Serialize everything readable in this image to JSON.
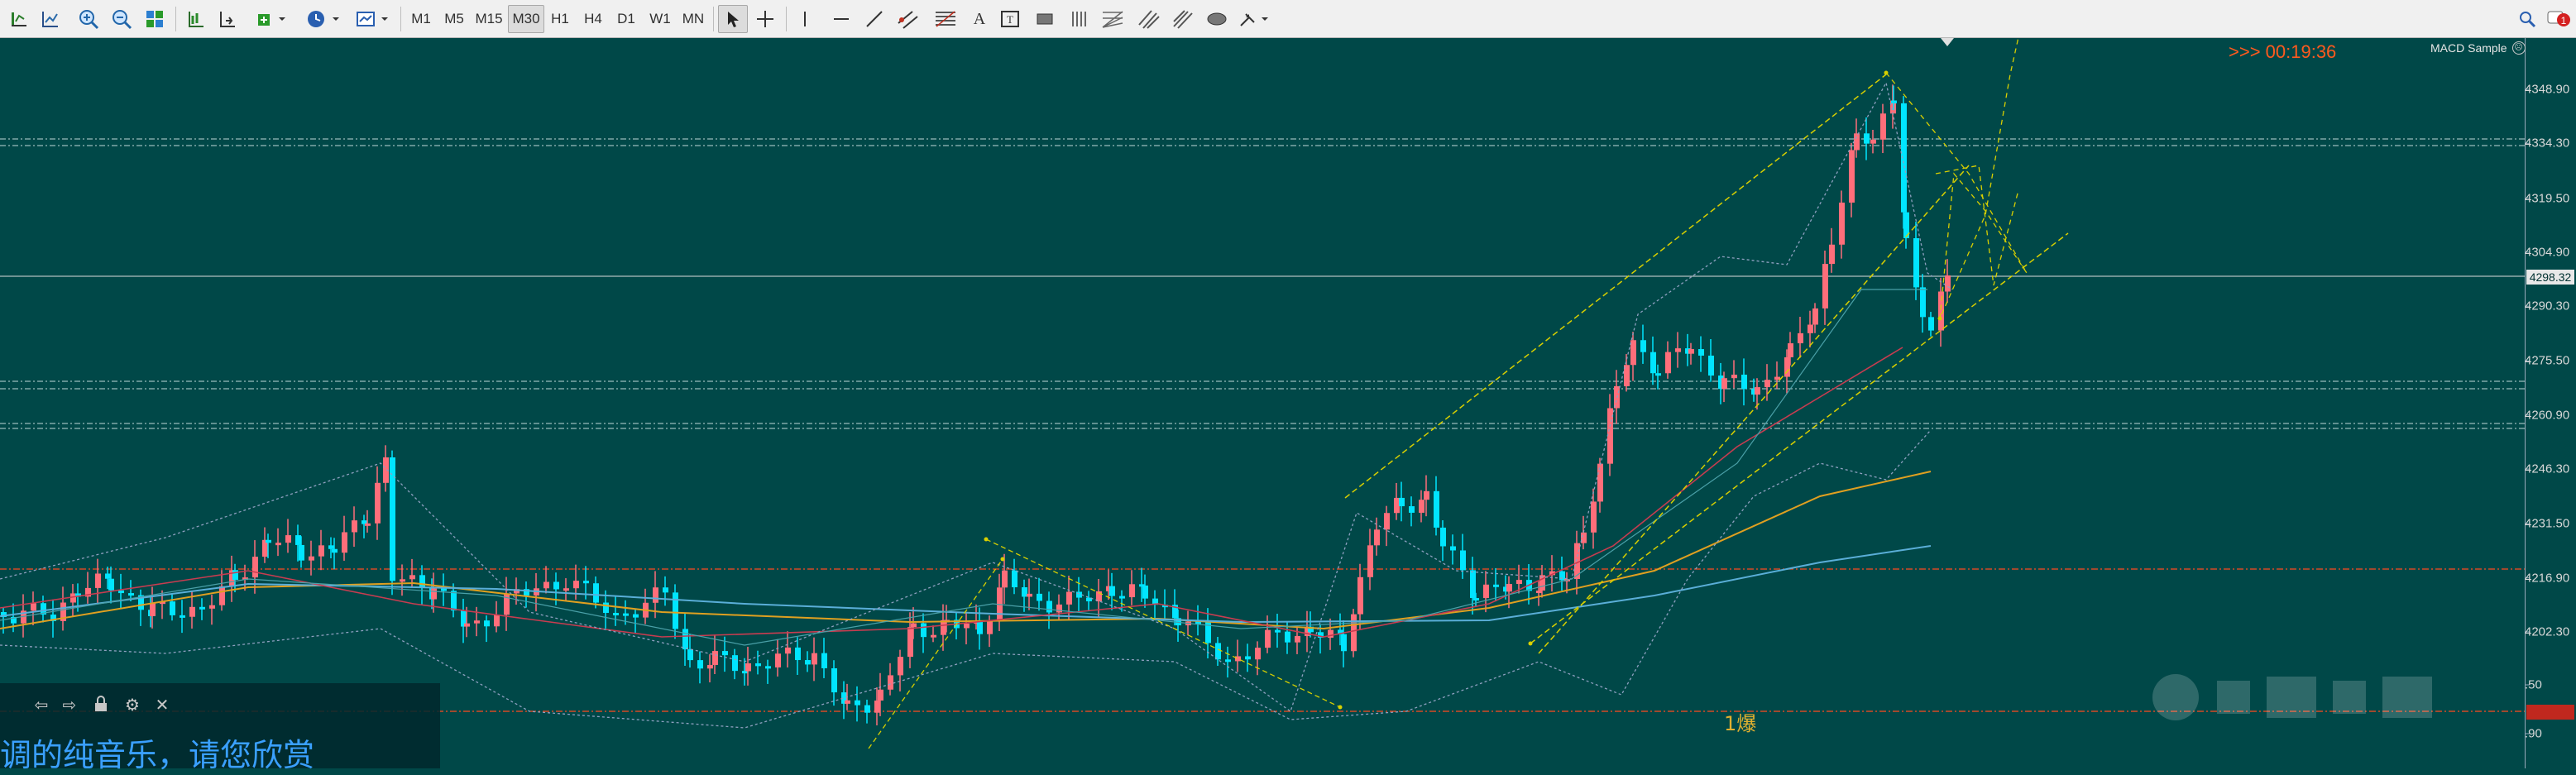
{
  "toolbar": {
    "timeframes": [
      "M1",
      "M5",
      "M15",
      "M30",
      "H1",
      "H4",
      "D1",
      "W1",
      "MN"
    ],
    "active_timeframe": "M30",
    "text_tool": "A",
    "text_label_tool": "T"
  },
  "chart": {
    "current_price_tag": "4298.32",
    "countdown": ">>> 00:19:36",
    "expert_advisor": "MACD Sample",
    "annotation": "1爆",
    "price_labels": [
      "4348.90",
      "4334.30",
      "4319.50",
      "4304.90",
      "4290.30",
      "4275.50",
      "4260.90",
      "4246.30",
      "4231.50",
      "4216.90",
      "4202.30",
      ".50",
      ".90"
    ],
    "red_tag": ""
  },
  "player": {
    "marquee_text": "调的纯音乐，请您欣赏"
  },
  "colors": {
    "background": "#004848",
    "bull": "#ff6e7a",
    "bear": "#00e5ff",
    "support": "#c0d8d8",
    "resistance": "#ff4a1e",
    "trendline": "#d8d000"
  }
}
